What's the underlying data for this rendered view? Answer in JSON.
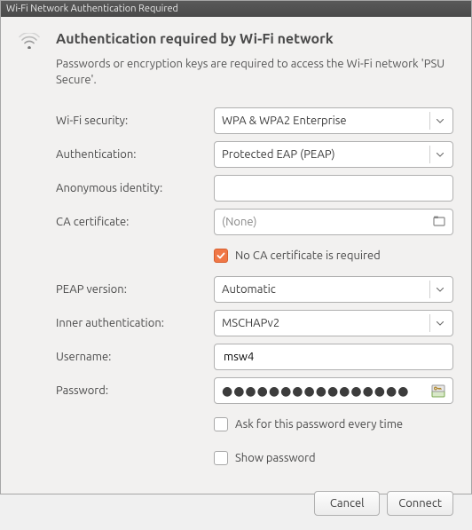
{
  "window": {
    "title": "Wi-Fi Network Authentication Required"
  },
  "header": {
    "heading": "Authentication required by Wi-Fi network",
    "subtext": "Passwords or encryption keys are required to access the Wi-Fi network 'PSU Secure'."
  },
  "labels": {
    "wifi_security": "Wi-Fi security:",
    "authentication": "Authentication:",
    "anonymous_identity": "Anonymous identity:",
    "ca_certificate": "CA certificate:",
    "peap_version": "PEAP version:",
    "inner_auth": "Inner authentication:",
    "username": "Username:",
    "password": "Password:"
  },
  "values": {
    "wifi_security": "WPA & WPA2 Enterprise",
    "authentication": "Protected EAP (PEAP)",
    "anonymous_identity": "",
    "ca_certificate": "(None)",
    "no_ca_required_checked": true,
    "peap_version": "Automatic",
    "inner_auth": "MSCHAPv2",
    "username": "msw4",
    "password_mask": "●●●●●●●●●●●●●●●●",
    "ask_every_time_checked": false,
    "show_password_checked": false
  },
  "checkboxes": {
    "no_ca_required": "No CA certificate is required",
    "ask_every_time": "Ask for this password every time",
    "show_password": "Show password"
  },
  "buttons": {
    "cancel": "Cancel",
    "connect": "Connect"
  }
}
